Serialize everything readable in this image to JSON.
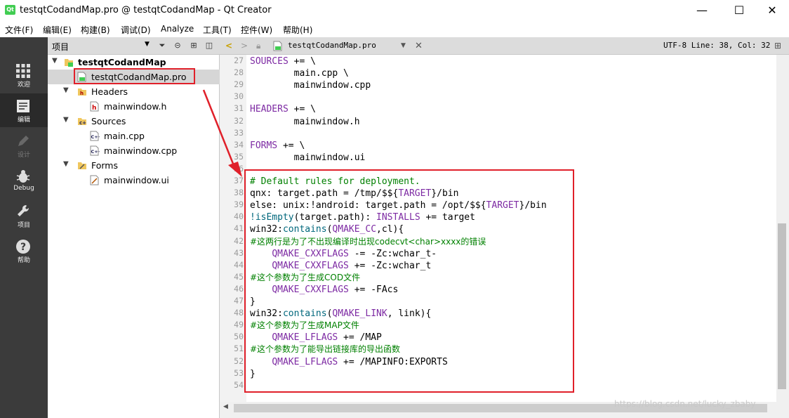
{
  "window": {
    "title": "testqtCodandMap.pro @ testqtCodandMap - Qt Creator",
    "app_icon": "Qt",
    "minimize": "—",
    "maximize": "☐",
    "close": "✕"
  },
  "menu": [
    "文件(F)",
    "编辑(E)",
    "构建(B)",
    "调试(D)",
    "Analyze",
    "工具(T)",
    "控件(W)",
    "帮助(H)"
  ],
  "modes": [
    {
      "label": "欢迎",
      "icon": "grid-icon",
      "active": false,
      "enabled": true
    },
    {
      "label": "编辑",
      "icon": "document-icon",
      "active": true,
      "enabled": true
    },
    {
      "label": "设计",
      "icon": "pencil-icon",
      "active": false,
      "enabled": false
    },
    {
      "label": "Debug",
      "icon": "bug-icon",
      "active": false,
      "enabled": true
    },
    {
      "label": "项目",
      "icon": "wrench-icon",
      "active": false,
      "enabled": true
    },
    {
      "label": "帮助",
      "icon": "help-icon",
      "active": false,
      "enabled": true
    }
  ],
  "project_panel": {
    "title": "项目",
    "tree": [
      {
        "text": "testqtCodandMap",
        "level": 0,
        "arrow": "▼",
        "icon": "pro",
        "bold": true
      },
      {
        "text": "testqtCodandMap.pro",
        "level": 1,
        "arrow": "",
        "icon": "pro",
        "selected": true
      },
      {
        "text": "Headers",
        "level": 1,
        "arrow": "▼",
        "icon": "folder-h"
      },
      {
        "text": "mainwindow.h",
        "level": 2,
        "arrow": "",
        "icon": "h"
      },
      {
        "text": "Sources",
        "level": 1,
        "arrow": "▼",
        "icon": "folder-c"
      },
      {
        "text": "main.cpp",
        "level": 2,
        "arrow": "",
        "icon": "cpp"
      },
      {
        "text": "mainwindow.cpp",
        "level": 2,
        "arrow": "",
        "icon": "cpp"
      },
      {
        "text": "Forms",
        "level": 1,
        "arrow": "▼",
        "icon": "folder-f"
      },
      {
        "text": "mainwindow.ui",
        "level": 2,
        "arrow": "",
        "icon": "ui"
      }
    ]
  },
  "editor": {
    "filename": "testqtCodandMap.pro",
    "position": "UTF-8 Line: 38, Col: 32",
    "first_line": 27,
    "lines": [
      [
        [
          "k",
          "SOURCES"
        ],
        [
          "n",
          " += \\"
        ]
      ],
      [
        [
          "n",
          "        main.cpp \\"
        ]
      ],
      [
        [
          "n",
          "        mainwindow.cpp"
        ]
      ],
      [],
      [
        [
          "k",
          "HEADERS"
        ],
        [
          "n",
          " += \\"
        ]
      ],
      [
        [
          "n",
          "        mainwindow.h"
        ]
      ],
      [],
      [
        [
          "k",
          "FORMS"
        ],
        [
          "n",
          " += \\"
        ]
      ],
      [
        [
          "n",
          "        mainwindow.ui"
        ]
      ],
      [],
      [
        [
          "c",
          "# Default rules for deployment."
        ]
      ],
      [
        [
          "n",
          "qnx: target.path = /tmp/$${"
        ],
        [
          "k",
          "TARGET"
        ],
        [
          "n",
          "}/bin"
        ]
      ],
      [
        [
          "n",
          "else: unix:!android: target.path = /opt/$${"
        ],
        [
          "k",
          "TARGET"
        ],
        [
          "n",
          "}/bin"
        ]
      ],
      [
        [
          "f",
          "!isEmpty"
        ],
        [
          "n",
          "(target.path): "
        ],
        [
          "k",
          "INSTALLS"
        ],
        [
          "n",
          " += target"
        ]
      ],
      [
        [
          "n",
          "win32:"
        ],
        [
          "f",
          "contains"
        ],
        [
          "n",
          "("
        ],
        [
          "k",
          "QMAKE_CC"
        ],
        [
          "n",
          ",cl){"
        ]
      ],
      [
        [
          "z",
          "#这两行是为了不出现编译时出现codecvt<char>xxxx的错误"
        ]
      ],
      [
        [
          "n",
          "    "
        ],
        [
          "k",
          "QMAKE_CXXFLAGS"
        ],
        [
          "n",
          " -= -Zc:wchar_t-"
        ]
      ],
      [
        [
          "n",
          "    "
        ],
        [
          "k",
          "QMAKE_CXXFLAGS"
        ],
        [
          "n",
          " += -Zc:wchar_t"
        ]
      ],
      [
        [
          "z",
          "#这个参数为了生成COD文件"
        ]
      ],
      [
        [
          "n",
          "    "
        ],
        [
          "k",
          "QMAKE_CXXFLAGS"
        ],
        [
          "n",
          " += -FAcs"
        ]
      ],
      [
        [
          "n",
          "}"
        ]
      ],
      [
        [
          "n",
          "win32:"
        ],
        [
          "f",
          "contains"
        ],
        [
          "n",
          "("
        ],
        [
          "k",
          "QMAKE_LINK"
        ],
        [
          "n",
          ", link){"
        ]
      ],
      [
        [
          "z",
          "#这个参数为了生成MAP文件"
        ]
      ],
      [
        [
          "n",
          "    "
        ],
        [
          "k",
          "QMAKE_LFLAGS"
        ],
        [
          "n",
          " += /MAP"
        ]
      ],
      [
        [
          "z",
          "#这个参数为了能导出链接库的导出函数"
        ]
      ],
      [
        [
          "n",
          "    "
        ],
        [
          "k",
          "QMAKE_LFLAGS"
        ],
        [
          "n",
          " += /MAPINFO:EXPORTS"
        ]
      ],
      [
        [
          "n",
          "}"
        ]
      ],
      []
    ]
  },
  "watermark": "https://blog.csdn.net/lucky_zbaby",
  "colors": {
    "keyword": "#7d2aa3",
    "comment": "#008000",
    "function": "#00677c",
    "annotation": "#e0202a",
    "mode_bar": "#3b3b3b"
  }
}
